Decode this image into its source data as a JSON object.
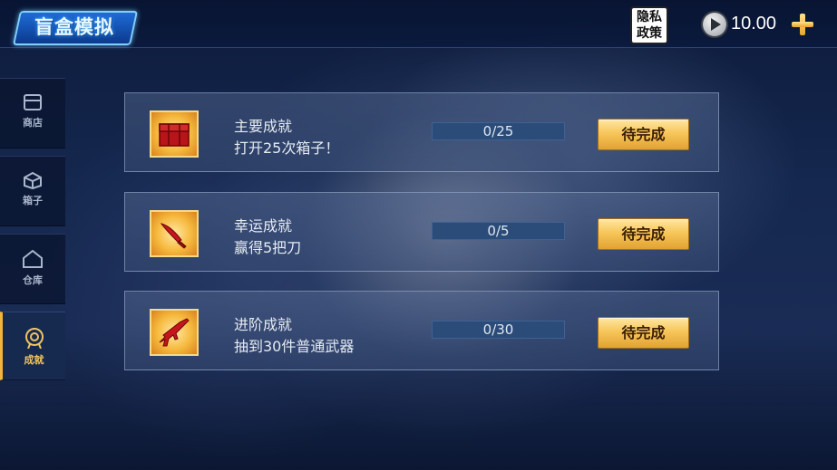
{
  "app": {
    "logo_text": "盲盒模拟"
  },
  "header": {
    "privacy_line1": "隐私",
    "privacy_line2": "政策",
    "coin_value": "10.00",
    "coin_icon": "play-coin-icon",
    "add_icon": "plus-icon"
  },
  "sidebar": {
    "items": [
      {
        "label": "商店",
        "icon": "shop-icon",
        "active": false
      },
      {
        "label": "箱子",
        "icon": "crate-icon",
        "active": false
      },
      {
        "label": "仓库",
        "icon": "warehouse-icon",
        "active": false
      },
      {
        "label": "成就",
        "icon": "medal-icon",
        "active": true
      }
    ]
  },
  "achievements": [
    {
      "title": "主要成就",
      "desc": "打开25次箱子！",
      "icon": "chest-icon",
      "progress_text": "0/25",
      "progress": 0,
      "button": "待完成"
    },
    {
      "title": "幸运成就",
      "desc": "赢得5把刀",
      "icon": "knife-icon",
      "progress_text": "0/5",
      "progress": 0,
      "button": "待完成"
    },
    {
      "title": "进阶成就",
      "desc": "抽到30件普通武器",
      "icon": "rifle-icon",
      "progress_text": "0/30",
      "progress": 0,
      "button": "待完成"
    }
  ],
  "colors": {
    "accent_gold": "#f2b53c",
    "progress_track": "#2b4c78",
    "icon_red": "#b8141a"
  }
}
